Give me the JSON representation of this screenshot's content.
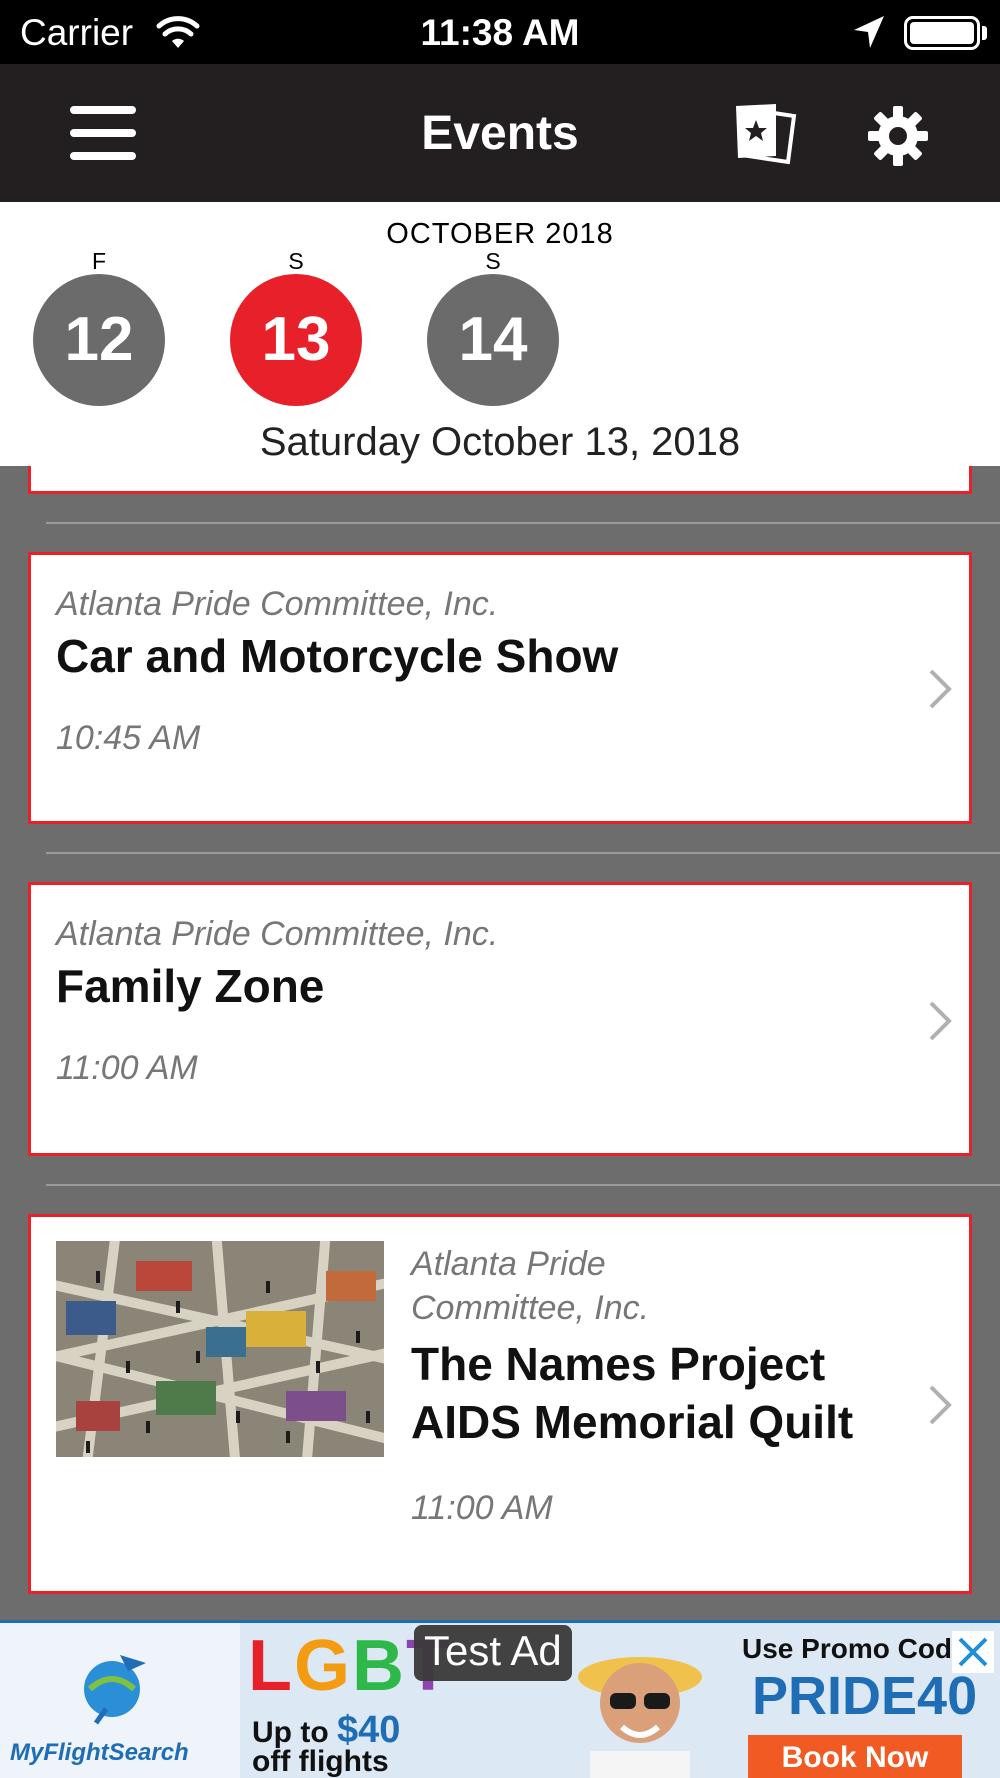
{
  "status_bar": {
    "carrier": "Carrier",
    "time": "11:38 AM"
  },
  "nav": {
    "title": "Events",
    "icons": [
      "menu-icon",
      "tickets-icon",
      "gear-icon"
    ]
  },
  "date_picker": {
    "month": "OCTOBER 2018",
    "days": [
      {
        "dow": "F",
        "num": "12",
        "selected": false
      },
      {
        "dow": "S",
        "num": "13",
        "selected": true
      },
      {
        "dow": "S",
        "num": "14",
        "selected": false
      }
    ],
    "selected_label": "Saturday October 13, 2018"
  },
  "events": [
    {
      "org": "Atlanta Pride Committee, Inc.",
      "name": "Car and Motorcycle Show",
      "time": "10:45 AM"
    },
    {
      "org": "Atlanta Pride Committee, Inc.",
      "name": "Family Zone",
      "time": "11:00 AM"
    },
    {
      "org_line1": "Atlanta Pride",
      "org_line2": "Committee, Inc.",
      "name_line1": "The Names Project",
      "name_line2": "AIDS Memorial Quilt",
      "time": "11:00 AM"
    }
  ],
  "ad": {
    "badge": "Test Ad",
    "brand": "MyFlightSearch",
    "headline": [
      "L",
      "G",
      "B",
      "T"
    ],
    "upto": "Up to",
    "amount": "$40",
    "off": "off flights",
    "promo": "Use Promo Cod",
    "code": "PRIDE40",
    "cta": "Book Now"
  },
  "colors": {
    "accent_red": "#e8202a",
    "nav_bg": "#231f20",
    "list_bg": "#6d6d6d",
    "day_gray": "#6b6b6b"
  }
}
